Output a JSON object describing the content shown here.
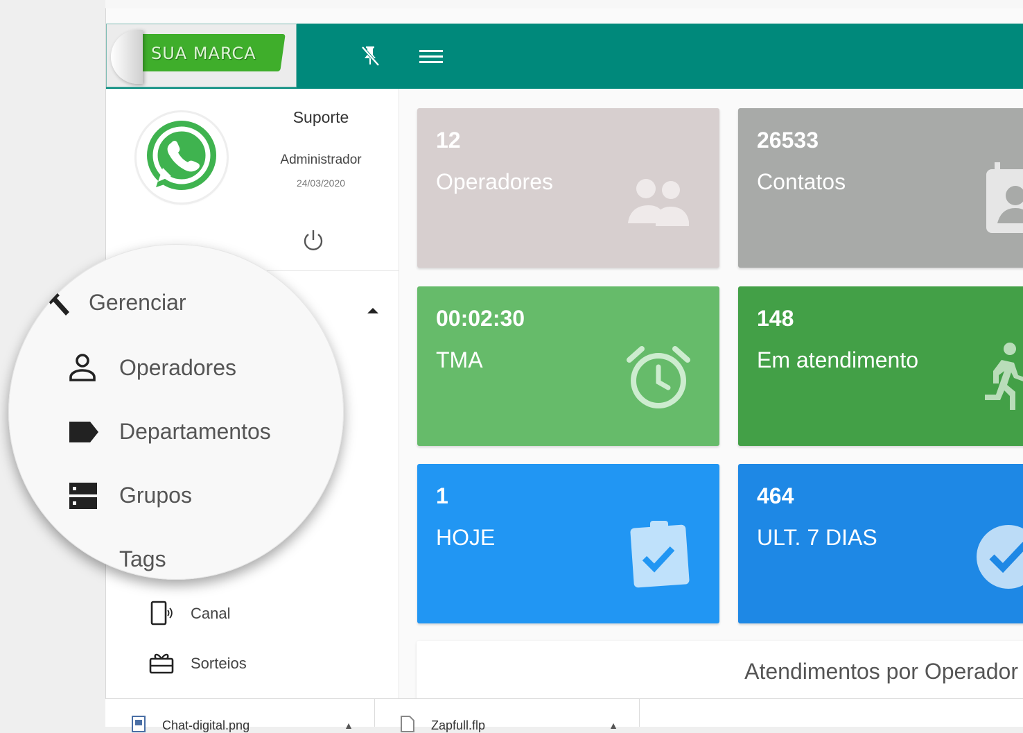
{
  "brand": {
    "logo_text": "SUA MARCA"
  },
  "user": {
    "name": "Suporte",
    "role": "Administrador",
    "date": "24/03/2020"
  },
  "menu": {
    "section_label": "Gerenciar",
    "items": [
      {
        "label": "Operadores",
        "icon": "person-icon"
      },
      {
        "label": "Departamentos",
        "icon": "label-tag-icon"
      },
      {
        "label": "Grupos",
        "icon": "dns-icon"
      },
      {
        "label": "Tags",
        "icon": "tag-icon"
      },
      {
        "label": "Canal",
        "icon": "phone-channel-icon"
      },
      {
        "label": "Sorteios",
        "icon": "gift-icon"
      }
    ]
  },
  "cards": [
    {
      "value": "12",
      "title": "Operadores",
      "color": "#d7cfcf",
      "icon": "people-icon"
    },
    {
      "value": "26533",
      "title": "Contatos",
      "color": "#a8aaa8",
      "icon": "contact-calendar-icon"
    },
    {
      "value": "00:02:30",
      "title": "TMA",
      "color": "#66bb6a",
      "icon": "alarm-icon"
    },
    {
      "value": "148",
      "title": "Em atendimento",
      "color": "#43a047",
      "icon": "running-person-icon"
    },
    {
      "value": "1",
      "title": "HOJE",
      "color": "#2196f3",
      "icon": "clipboard-check-icon"
    },
    {
      "value": "464",
      "title": "ULT. 7 DIAS",
      "color": "#1e88e5",
      "icon": "check-circle-icon"
    }
  ],
  "chart": {
    "title": "Atendimentos por Operador"
  },
  "downloads": [
    {
      "name": "Chat-digital.png"
    },
    {
      "name": "Zapfull.flp"
    }
  ],
  "colors": {
    "topbar": "#00897b",
    "accent": "#3fae2b"
  }
}
